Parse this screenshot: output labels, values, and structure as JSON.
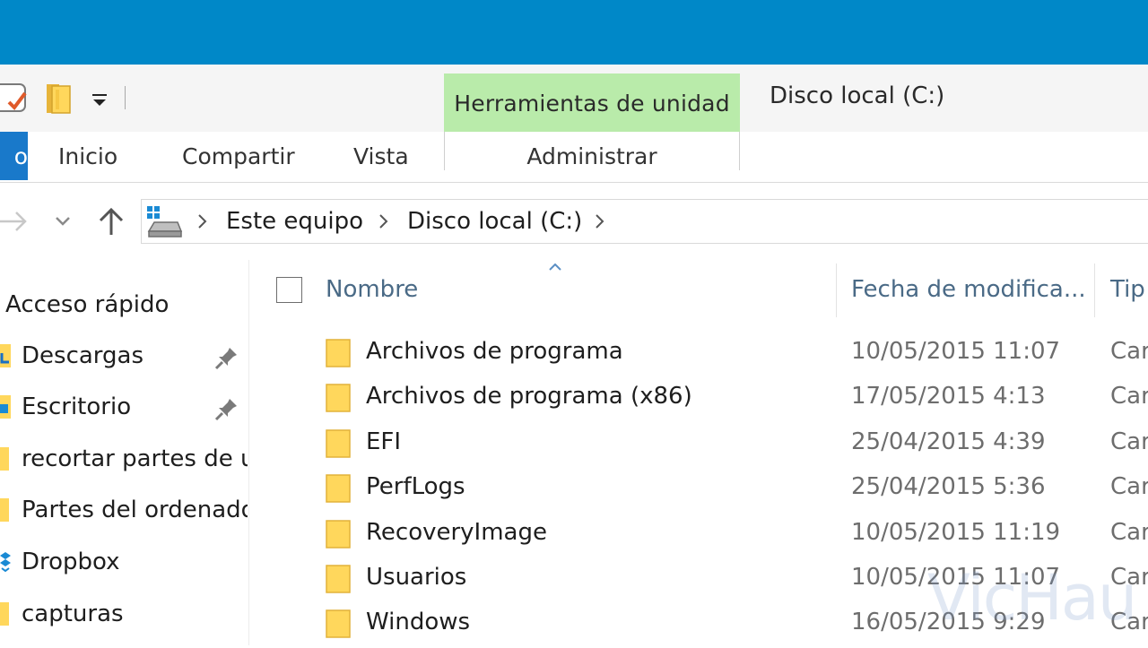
{
  "colors": {
    "title_bar": "#0088c8",
    "context_tab": "#b9ebaa",
    "file_tab": "#1979ca",
    "folder_yellow": "#ffd75c",
    "column_header_text": "#4a6a86"
  },
  "quick_access_toolbar": {
    "icons": [
      "properties-icon",
      "new-folder-icon",
      "customize-dropdown-icon"
    ]
  },
  "ribbon": {
    "context_group_label": "Herramientas de unidad",
    "window_title": "Disco local (C:)",
    "file_tab_label": "o",
    "tabs": [
      "Inicio",
      "Compartir",
      "Vista"
    ],
    "context_tab": "Administrar"
  },
  "address_bar": {
    "breadcrumbs": [
      "Este equipo",
      "Disco local (C:)"
    ],
    "icons": [
      "back-arrow-icon",
      "recent-locations-icon",
      "up-arrow-icon",
      "drive-icon",
      "chevron-right-icon"
    ]
  },
  "navigation_pane": {
    "heading": "Acceso rápido",
    "items": [
      {
        "label": "Descargas",
        "icon": "downloads-folder-icon",
        "pinned": true
      },
      {
        "label": "Escritorio",
        "icon": "desktop-folder-icon",
        "pinned": true
      },
      {
        "label": "recortar partes de u",
        "icon": "folder-icon",
        "pinned": false
      },
      {
        "label": "Partes del ordenado",
        "icon": "folder-icon",
        "pinned": false
      },
      {
        "label": "Dropbox",
        "icon": "dropbox-icon",
        "pinned": false
      },
      {
        "label": "capturas",
        "icon": "folder-icon",
        "pinned": false
      }
    ]
  },
  "file_list": {
    "columns": [
      "Nombre",
      "Fecha de modifica...",
      "Tip"
    ],
    "rows": [
      {
        "name": "Archivos de programa",
        "date": "10/05/2015 11:07",
        "type": "Car"
      },
      {
        "name": "Archivos de programa (x86)",
        "date": "17/05/2015 4:13",
        "type": "Car"
      },
      {
        "name": "EFI",
        "date": "25/04/2015 4:39",
        "type": "Car"
      },
      {
        "name": "PerfLogs",
        "date": "25/04/2015 5:36",
        "type": "Car"
      },
      {
        "name": "RecoveryImage",
        "date": "10/05/2015 11:19",
        "type": "Car"
      },
      {
        "name": "Usuarios",
        "date": "10/05/2015 11:07",
        "type": "Car"
      },
      {
        "name": "Windows",
        "date": "16/05/2015 9:29",
        "type": "Car"
      }
    ]
  },
  "watermark": "VicHau"
}
